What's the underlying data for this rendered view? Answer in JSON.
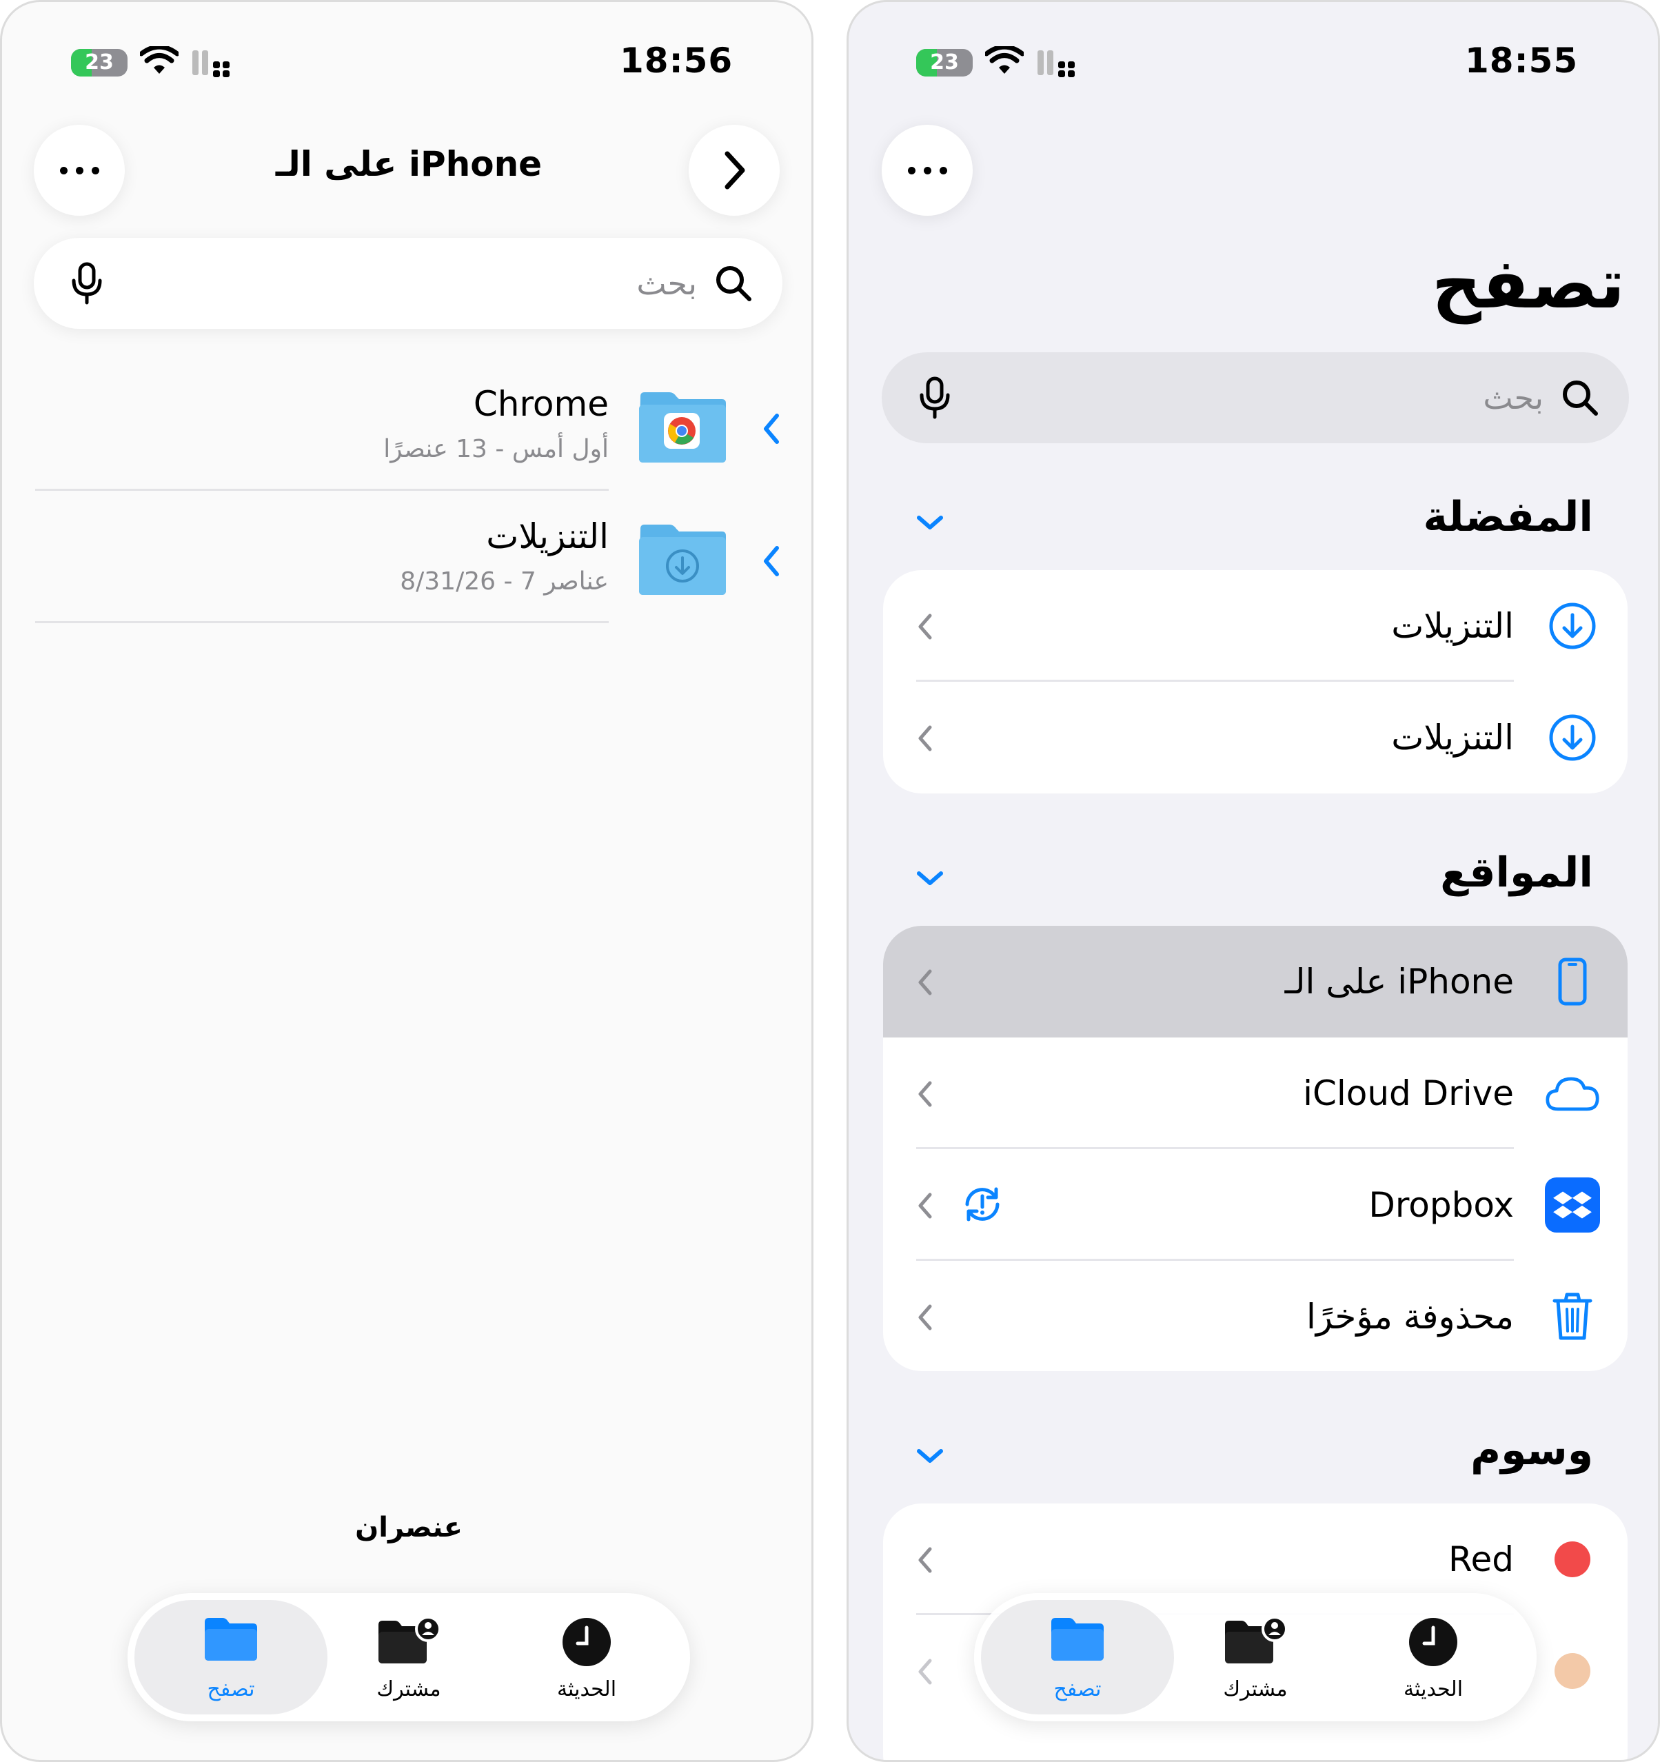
{
  "left": {
    "status": {
      "time": "18:56",
      "battery": "23"
    },
    "header": {
      "title": "على الـ iPhone",
      "more_icon": "ellipsis-icon",
      "forward_icon": "chevron-right-icon"
    },
    "search": {
      "placeholder": "بحث"
    },
    "files": [
      {
        "name": "Chrome",
        "meta": "أول أمس - 13 عنصرًا",
        "icon": "chrome-folder-icon"
      },
      {
        "name": "التنزيلات",
        "meta": "8/31/26 - 7 عناصر",
        "icon": "downloads-folder-icon"
      }
    ],
    "footer_count": "عنصران",
    "tabs": [
      {
        "label": "تصفح",
        "icon": "folder-icon",
        "active": true
      },
      {
        "label": "مشترك",
        "icon": "shared-folder-icon",
        "active": false
      },
      {
        "label": "الحديثة",
        "icon": "clock-icon",
        "active": false
      }
    ]
  },
  "right": {
    "status": {
      "time": "18:55",
      "battery": "23"
    },
    "large_title": "تصفح",
    "search": {
      "placeholder": "بحث"
    },
    "sections": {
      "favorites": {
        "title": "المفضلة",
        "items": [
          "التنزيلات",
          "التنزيلات"
        ]
      },
      "locations": {
        "title": "المواقع",
        "items": [
          "على الـ iPhone",
          "iCloud Drive",
          "Dropbox",
          "محذوفة مؤخرًا"
        ]
      },
      "tags": {
        "title": "وسوم",
        "items": [
          "Red"
        ]
      }
    },
    "colors": {
      "accent": "#0a84ff",
      "red_tag": "#f24a4a",
      "orange_tag": "#f3c9a8",
      "selected_row": "#d1d1d6"
    },
    "tabs": [
      {
        "label": "تصفح",
        "icon": "folder-icon",
        "active": true
      },
      {
        "label": "مشترك",
        "icon": "shared-folder-icon",
        "active": false
      },
      {
        "label": "الحديثة",
        "icon": "clock-icon",
        "active": false
      }
    ]
  }
}
